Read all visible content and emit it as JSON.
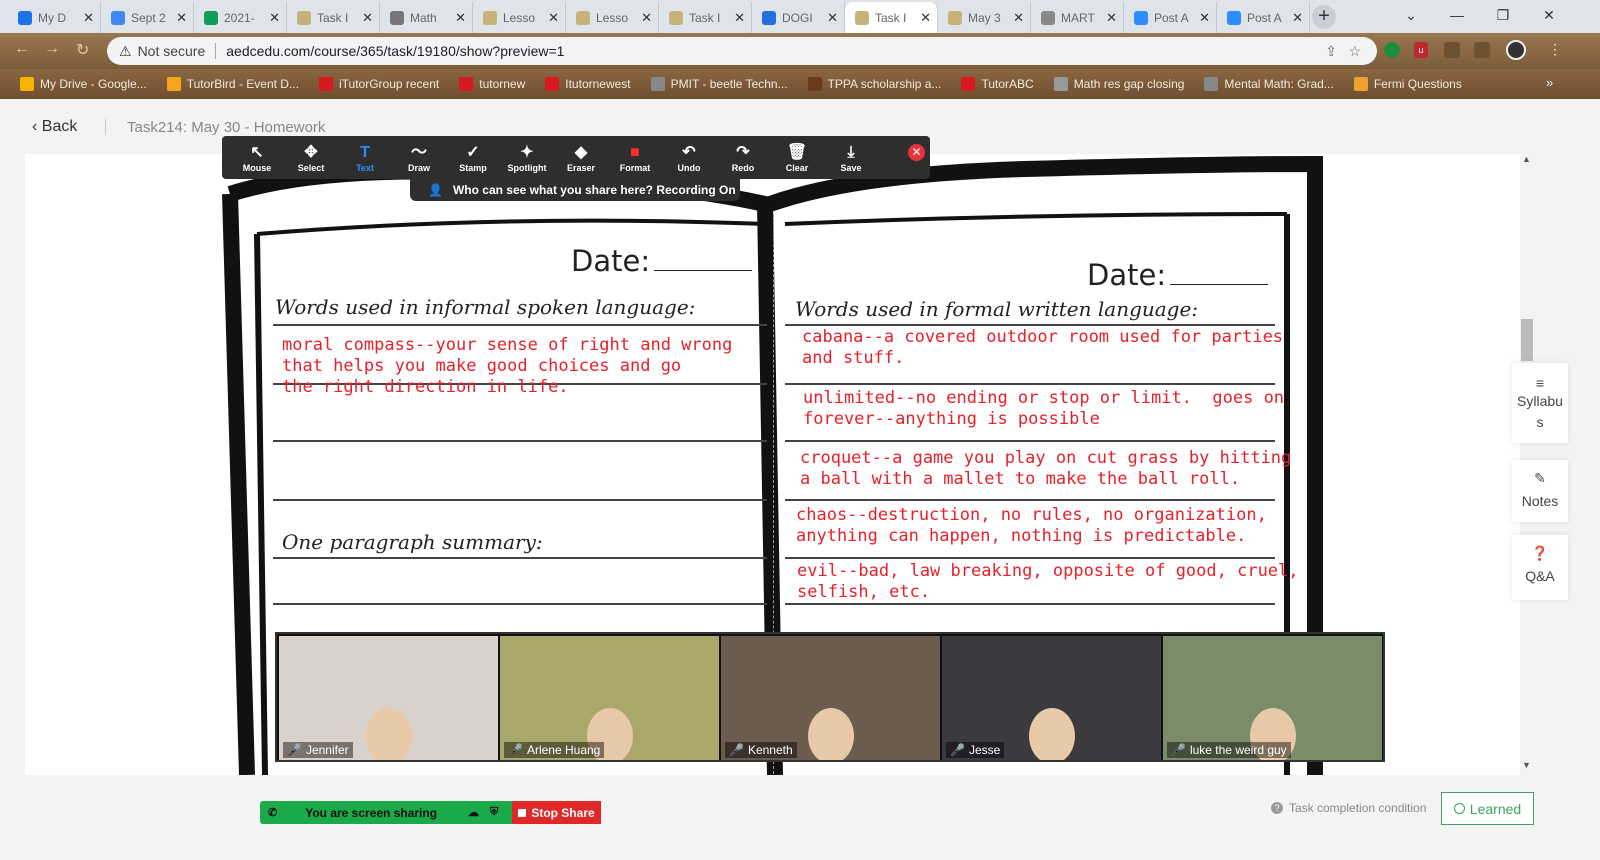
{
  "browser": {
    "tabs": [
      {
        "label": "My D",
        "color": "#1a73e8"
      },
      {
        "label": "Sept 2",
        "color": "#4285f4"
      },
      {
        "label": "2021-",
        "color": "#0f9d58"
      },
      {
        "label": "Task I",
        "color": "#c7b27a"
      },
      {
        "label": "Math",
        "color": "#777"
      },
      {
        "label": "Lesso",
        "color": "#c7b27a"
      },
      {
        "label": "Lesso",
        "color": "#c7b27a"
      },
      {
        "label": "Task I",
        "color": "#c7b27a"
      },
      {
        "label": "DOGI",
        "color": "#1f6fe0"
      },
      {
        "label": "Task I",
        "color": "#c7b27a"
      },
      {
        "label": "May 3",
        "color": "#c7b27a"
      },
      {
        "label": "MART",
        "color": "#888"
      },
      {
        "label": "Post A",
        "color": "#2d8cff"
      },
      {
        "label": "Post A",
        "color": "#2d8cff"
      }
    ],
    "active_tab": 9,
    "new_tab": "+",
    "not_secure": "Not secure",
    "url": "aedcedu.com/course/365/task/19180/show?preview=1",
    "bookmarks": [
      {
        "label": "My Drive - Google...",
        "color": "#f4b400"
      },
      {
        "label": "TutorBird - Event D...",
        "color": "#f7a41d"
      },
      {
        "label": "iTutorGroup recent",
        "color": "#d71920"
      },
      {
        "label": "tutornew",
        "color": "#d71920"
      },
      {
        "label": "Itutornewest",
        "color": "#d71920"
      },
      {
        "label": "PMIT - beetle Techn...",
        "color": "#888"
      },
      {
        "label": "TPPA scholarship a...",
        "color": "#6b3b1e"
      },
      {
        "label": "TutorABC",
        "color": "#d71920"
      },
      {
        "label": "Math res gap closing",
        "color": "#999"
      },
      {
        "label": "Mental Math: Grad...",
        "color": "#888"
      },
      {
        "label": "Fermi Questions",
        "color": "#f0a030"
      }
    ]
  },
  "page": {
    "back": "Back",
    "task_title": "Task214:  May 30 - Homework"
  },
  "zoom": {
    "tools": [
      {
        "icon": "↖",
        "label": "Mouse",
        "name": "mouse-tool"
      },
      {
        "icon": "✥",
        "label": "Select",
        "name": "select-tool"
      },
      {
        "icon": "T",
        "label": "Text",
        "name": "text-tool"
      },
      {
        "icon": "〜",
        "label": "Draw",
        "name": "draw-tool"
      },
      {
        "icon": "✓",
        "label": "Stamp",
        "name": "stamp-tool"
      },
      {
        "icon": "✦",
        "label": "Spotlight",
        "name": "spotlight-tool"
      },
      {
        "icon": "◆",
        "label": "Eraser",
        "name": "eraser-tool"
      },
      {
        "icon": "■",
        "label": "Format",
        "name": "format-tool"
      },
      {
        "icon": "↶",
        "label": "Undo",
        "name": "undo-tool"
      },
      {
        "icon": "↷",
        "label": "Redo",
        "name": "redo-tool"
      },
      {
        "icon": "🗑",
        "label": "Clear",
        "name": "clear-tool"
      },
      {
        "icon": "⤓",
        "label": "Save",
        "name": "save-tool"
      }
    ],
    "selected_tool": "Text",
    "format_color": "#ff2a2a",
    "recording": "Who can see what you share here? Recording On"
  },
  "worksheet": {
    "date_label": "Date:",
    "left_heading": "Words used in informal spoken language:",
    "right_heading": "Words used in formal written language:",
    "summary_heading": "One paragraph summary:",
    "left_entries": [
      "moral compass--your sense of right and wrong\nthat helps you make good choices and go\nthe right direction in life."
    ],
    "right_entries": [
      "cabana--a covered outdoor room used for parties\nand stuff.",
      "unlimited--no ending or stop or limit.  goes on\nforever--anything is possible",
      "croquet--a game you play on cut grass by hitting\na ball with a mallet to make the ball roll.",
      "chaos--destruction, no rules, no organization,\nanything can happen, nothing is predictable.",
      "evil--bad, law breaking, opposite of good, cruel,\nselfish, etc."
    ],
    "annotation_color": "#e8202a"
  },
  "participants": [
    {
      "name": "Jennifer",
      "bg": "#d9d2cc"
    },
    {
      "name": "Arlene Huang",
      "bg": "#a9a86a"
    },
    {
      "name": "Kenneth",
      "bg": "#6b5c4e"
    },
    {
      "name": "Jesse",
      "bg": "#3c3a3e"
    },
    {
      "name": "luke the weird guy",
      "bg": "#7a8c6a"
    }
  ],
  "side_panel": {
    "syllabus": "Syllabu\ns",
    "notes": "Notes",
    "qa": "Q&A"
  },
  "bottom": {
    "sharing": "You are screen sharing",
    "stop_share": "Stop Share",
    "completion": "Task completion condition",
    "learned": "Learned"
  }
}
